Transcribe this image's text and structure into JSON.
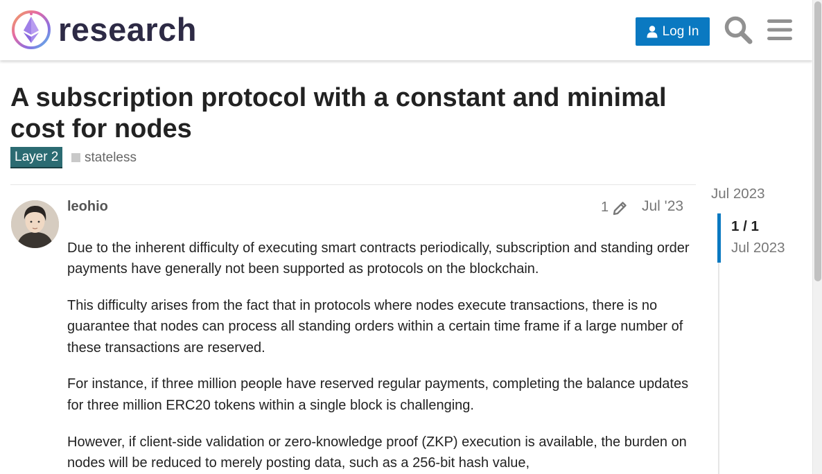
{
  "header": {
    "site_name": "research",
    "login_label": "Log In",
    "brand_color": "#0a79c1"
  },
  "topic": {
    "title": "A subscription protocol with a constant and minimal cost for nodes",
    "category": "Layer 2",
    "category_color": "#2b6b72",
    "tag": "stateless"
  },
  "post": {
    "username": "leohio",
    "edit_count": "1",
    "date": "Jul '23",
    "paragraphs": [
      "Due to the inherent difficulty of executing smart contracts periodically, subscription and standing order payments have generally not been supported as protocols on the blockchain.",
      "This difficulty arises from the fact that in protocols where nodes execute transactions, there is no guarantee that nodes can process all standing orders within a certain time frame if a large number of these transactions are reserved.",
      "For instance, if three million people have reserved regular payments, completing the balance updates for three million ERC20 tokens within a single block is challenging.",
      "However, if client-side validation or zero-knowledge proof (ZKP) execution is available, the burden on nodes will be reduced to merely posting data, such as a 256-bit hash value,"
    ]
  },
  "timeline": {
    "start_date": "Jul 2023",
    "position": "1 / 1",
    "current_date": "Jul 2023"
  },
  "icons": {
    "logo": "ethereum-research-logo",
    "user": "user-icon",
    "search": "search-icon",
    "menu": "hamburger-menu-icon",
    "edit": "pencil-icon"
  }
}
